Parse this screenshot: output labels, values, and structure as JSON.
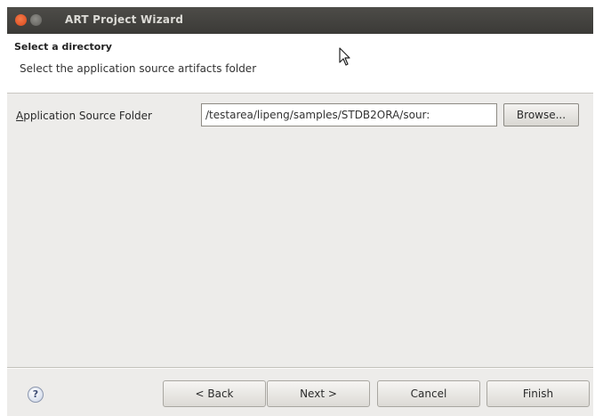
{
  "window": {
    "title": "ART Project Wizard"
  },
  "header": {
    "title": "Select a directory",
    "description": "Select the application source artifacts folder"
  },
  "form": {
    "label_prefix": "A",
    "label_rest": "pplication Source Folder",
    "source_folder_value": "/testarea/lipeng/samples/STDB2ORA/sour:",
    "browse_label": "Browse..."
  },
  "footer": {
    "help_icon_glyph": "?",
    "back_label": "< Back",
    "next_label": "Next >",
    "cancel_label": "Cancel",
    "finish_label": "Finish"
  },
  "icons": {
    "close": "close-icon",
    "minimize": "minimize-icon",
    "help": "help-icon",
    "cursor": "mouse-pointer-icon"
  },
  "colors": {
    "titlebar": "#3b3a37",
    "close_button": "#d8461b",
    "window_bg": "#edecea"
  }
}
